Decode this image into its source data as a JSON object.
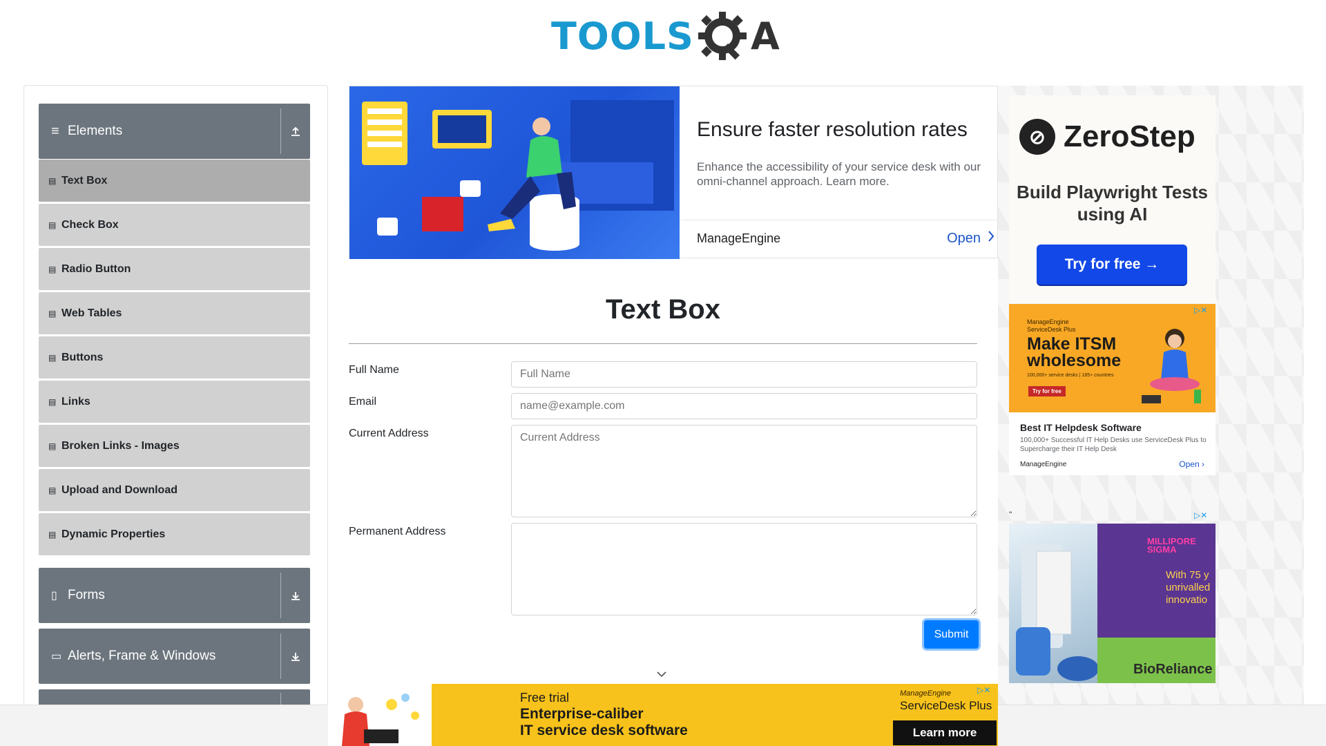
{
  "header": {
    "logo_text_1": "TOOLS",
    "logo_text_2": "A",
    "logo_gear_letter": "Q"
  },
  "sidebar": {
    "groups": [
      {
        "label": "Elements",
        "icon": "hamburger-icon",
        "toggle": "collapse-up-icon"
      },
      {
        "label": "Forms",
        "icon": "document-icon",
        "toggle": "expand-down-icon"
      },
      {
        "label": "Alerts, Frame & Windows",
        "icon": "window-icon",
        "toggle": "expand-down-icon"
      }
    ],
    "items": [
      {
        "label": "Text Box"
      },
      {
        "label": "Check Box"
      },
      {
        "label": "Radio Button"
      },
      {
        "label": "Web Tables"
      },
      {
        "label": "Buttons"
      },
      {
        "label": "Links"
      },
      {
        "label": "Broken Links - Images"
      },
      {
        "label": "Upload and Download"
      },
      {
        "label": "Dynamic Properties"
      }
    ]
  },
  "top_ad": {
    "title": "Ensure faster resolution rates",
    "description": "Enhance the accessibility of your service desk with our omni-channel approach. Learn more.",
    "brand": "ManageEngine",
    "cta": "Open"
  },
  "main": {
    "title": "Text Box",
    "fields": {
      "full_name": {
        "label": "Full Name",
        "placeholder": "Full Name",
        "value": ""
      },
      "email": {
        "label": "Email",
        "placeholder": "name@example.com",
        "value": ""
      },
      "current_address": {
        "label": "Current Address",
        "placeholder": "Current Address",
        "value": ""
      },
      "permanent_address": {
        "label": "Permanent Address",
        "placeholder": "",
        "value": ""
      }
    },
    "submit_label": "Submit"
  },
  "right_ads": {
    "zerostep": {
      "brand": "ZeroStep",
      "headline": "Build Playwright Tests using AI",
      "cta": "Try for free →"
    },
    "manageengine": {
      "art_brand": "ManageEngine ServiceDesk Plus",
      "art_headline": "Make ITSM wholesome",
      "art_small": "100,000+ service desks | 185+ countries",
      "art_cta": "Try for free",
      "title": "Best IT Helpdesk Software",
      "description": "100,000+ Successful IT Help Desks use ServiceDesk Plus to Supercharge their IT Help Desk",
      "brand": "ManageEngine",
      "cta": "Open"
    },
    "millipore": {
      "quote_mark": "\"",
      "logo": "MILLIPORE SIGMA",
      "text": "With 75 y\nunrivalled\ninnovatio",
      "brand": "BioReliance"
    }
  },
  "bottom_ad": {
    "line0": "Free trial",
    "line1": "Enterprise-caliber",
    "line2": "IT service desk software",
    "brand": "ManageEngine",
    "product": "ServiceDesk Plus",
    "cta": "Learn more"
  },
  "colors": {
    "accent": "#007bff",
    "sidebar_header": "#6c757d",
    "logo_blue": "#1999cf"
  }
}
